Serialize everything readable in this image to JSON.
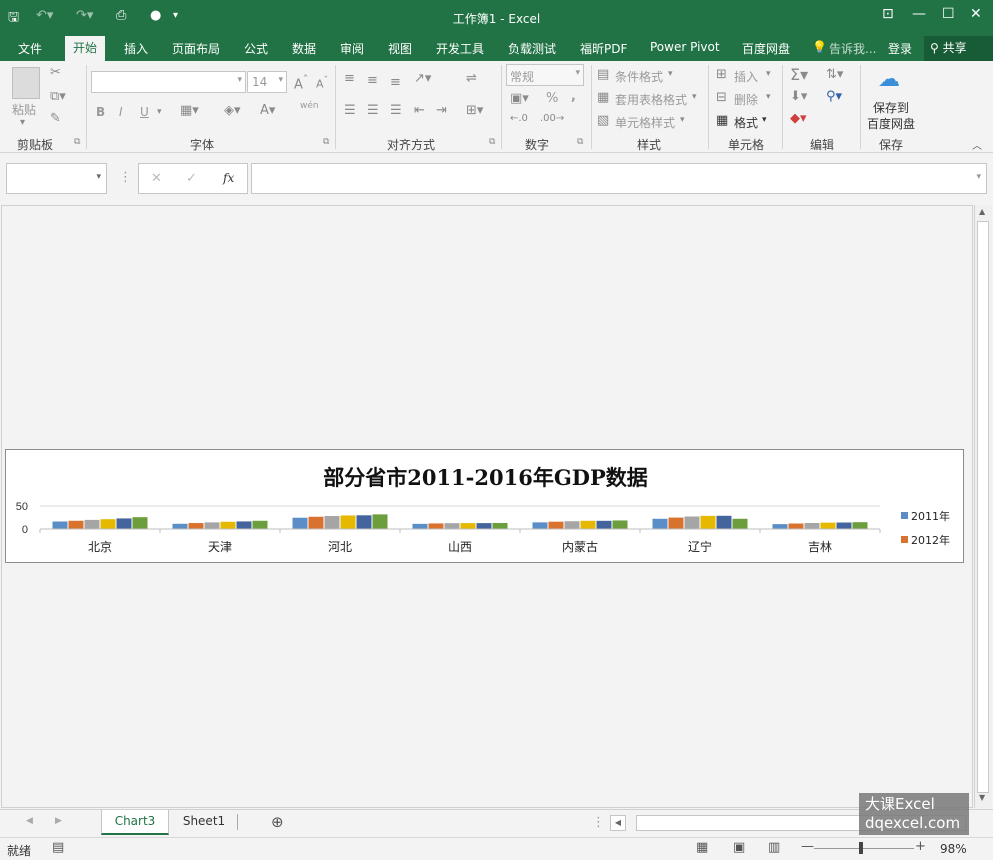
{
  "window": {
    "title": "工作簿1 - Excel"
  },
  "ribbon_tabs": [
    "文件",
    "开始",
    "插入",
    "页面布局",
    "公式",
    "数据",
    "审阅",
    "视图",
    "开发工具",
    "负载测试",
    "福昕PDF",
    "Power Pivot",
    "百度网盘"
  ],
  "tell_me": "告诉我...",
  "login": "登录",
  "share": "共享",
  "groups": {
    "clipboard": {
      "label": "剪贴板",
      "paste": "粘贴"
    },
    "font": {
      "label": "字体",
      "size": "14",
      "bold": "B",
      "italic": "I",
      "underline": "U",
      "wen": "wén"
    },
    "align": {
      "label": "对齐方式"
    },
    "number": {
      "label": "数字",
      "format": "常规",
      "percent": "%",
      "comma": ","
    },
    "styles": {
      "label": "样式",
      "cond": "条件格式",
      "table": "套用表格格式",
      "cell": "单元格样式"
    },
    "cells": {
      "label": "单元格",
      "insert": "插入",
      "delete": "删除",
      "format": "格式"
    },
    "edit": {
      "label": "编辑"
    },
    "save": {
      "label": "保存",
      "btn1": "保存到",
      "btn2": "百度网盘"
    }
  },
  "formula_bar": {
    "namebox": "",
    "fx": "fx",
    "formula": ""
  },
  "chart_data": {
    "type": "bar",
    "title": "部分省市2011-2016年GDP数据",
    "categories": [
      "北京",
      "天津",
      "河北",
      "山西",
      "内蒙古",
      "辽宁",
      "吉林"
    ],
    "ylim": [
      0,
      50
    ],
    "yticks": [
      "50",
      "0"
    ],
    "legend_position": "right",
    "series": [
      {
        "name": "2011年",
        "color": "#5b8ec6",
        "values": [
          16.3,
          11.3,
          24.5,
          11.2,
          14.4,
          22.2,
          10.6
        ]
      },
      {
        "name": "2012年",
        "color": "#d9712f",
        "values": [
          17.9,
          12.9,
          26.6,
          12.1,
          15.9,
          24.8,
          11.9
        ]
      },
      {
        "color": "#a5a5a5",
        "values": [
          19.8,
          14.4,
          28.3,
          12.7,
          16.9,
          27.2,
          13.0
        ]
      },
      {
        "color": "#e6b800",
        "values": [
          21.3,
          15.7,
          29.4,
          12.8,
          17.8,
          28.6,
          13.8
        ]
      },
      {
        "color": "#44649e",
        "values": [
          23.0,
          16.5,
          29.8,
          12.8,
          17.8,
          28.7,
          14.1
        ]
      },
      {
        "color": "#6c9e3e",
        "values": [
          25.7,
          17.9,
          31.8,
          13.1,
          18.6,
          22.2,
          14.8
        ]
      }
    ]
  },
  "sheets": [
    "Chart3",
    "Sheet1"
  ],
  "status": {
    "ready": "就绪",
    "zoom": "98%"
  },
  "watermark": {
    "line1": "大课Excel",
    "line2": "dqexcel.com"
  },
  "colors": {
    "excel_green": "#217346"
  }
}
